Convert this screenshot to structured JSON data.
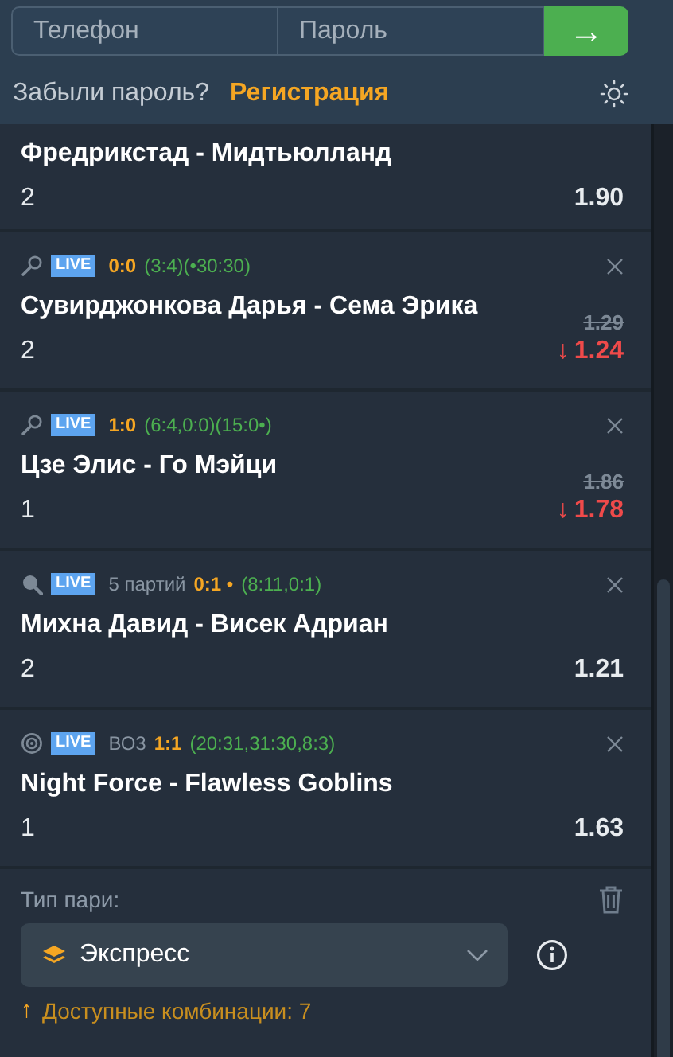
{
  "login": {
    "phone_placeholder": "Телефон",
    "password_placeholder": "Пароль",
    "submit": "→",
    "forgot": "Забыли пароль?",
    "register": "Регистрация"
  },
  "bets": [
    {
      "title": "Фредрикстад - Мидтьюлланд",
      "pick": "2",
      "odds": "1.90"
    },
    {
      "kind": "tennis",
      "badge": "LIVE",
      "score": "0:0",
      "details": "(3:4)(•30:30)",
      "title": "Сувирджонкова Дарья - Сема Эрика",
      "pick": "2",
      "old_odds": "1.29",
      "arrow": "↓",
      "odds": "1.24"
    },
    {
      "kind": "tennis",
      "badge": "LIVE",
      "score": "1:0",
      "details": "(6:4,0:0)(15:0•)",
      "title": "Цзе Элис - Го Мэйци",
      "pick": "1",
      "old_odds": "1.86",
      "arrow": "↓",
      "odds": "1.78"
    },
    {
      "kind": "table_tennis",
      "badge": "LIVE",
      "format": "5 партий",
      "score": "0:1 •",
      "details": "(8:11,0:1)",
      "title": "Михна Давид - Висек Адриан",
      "pick": "2",
      "odds": "1.21"
    },
    {
      "kind": "esports",
      "badge": "LIVE",
      "format": "ВО3",
      "score": "1:1",
      "details": "(20:31,31:30,8:3)",
      "title": "Night Force - Flawless Goblins",
      "pick": "1",
      "odds": "1.63"
    }
  ],
  "bet_type": {
    "label": "Тип пари:",
    "value": "Экспресс",
    "hint_arrow": "↑",
    "hint": "Доступные комбинации: 7"
  }
}
